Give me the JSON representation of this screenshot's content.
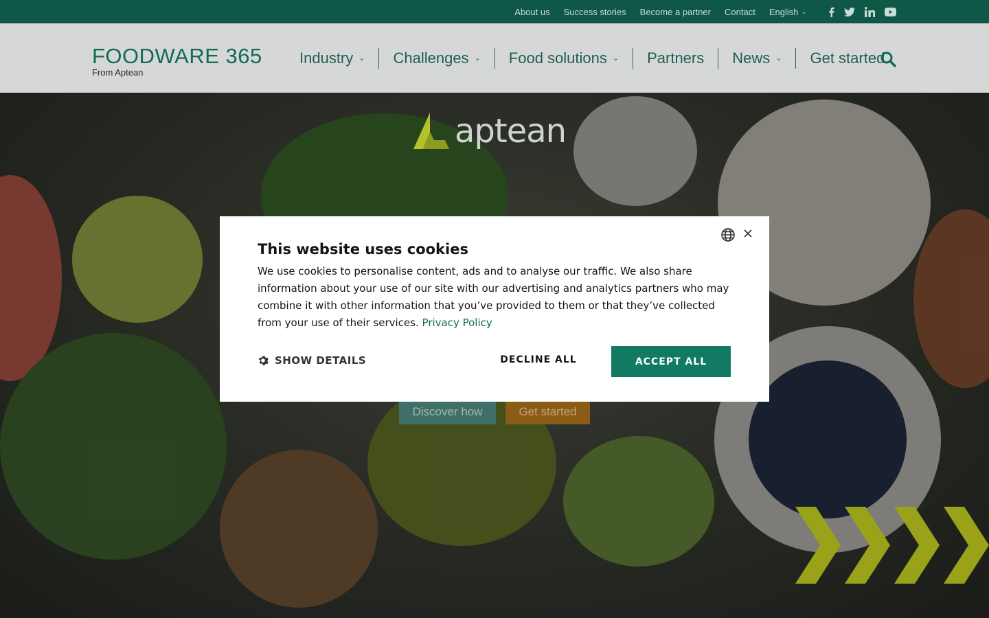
{
  "topbar": {
    "links": [
      "About us",
      "Success stories",
      "Become a partner",
      "Contact"
    ],
    "language": "English",
    "social_icons": [
      "facebook-icon",
      "twitter-icon",
      "linkedin-icon",
      "youtube-icon"
    ]
  },
  "header": {
    "logo_text": "FOODWARE 365",
    "logo_sub": "From Aptean",
    "nav": [
      {
        "label": "Industry",
        "dropdown": true
      },
      {
        "label": "Challenges",
        "dropdown": true
      },
      {
        "label": "Food solutions",
        "dropdown": true
      },
      {
        "label": "Partners",
        "dropdown": false
      },
      {
        "label": "News",
        "dropdown": true
      },
      {
        "label": "Get started",
        "dropdown": false
      }
    ],
    "search_icon": "search-icon"
  },
  "hero": {
    "brand_logo": "aptean",
    "buttons": {
      "discover": "Discover how",
      "get_started": "Get started"
    }
  },
  "cookie_modal": {
    "title": "This website uses cookies",
    "body": "We use cookies to personalise content, ads and to analyse our traffic. We also share information about your use of our site with our advertising and analytics partners who may combine it with other information that you’ve provided to them or that they’ve collected from your use of their services.",
    "privacy_link": "Privacy Policy",
    "show_details": "SHOW DETAILS",
    "decline": "DECLINE ALL",
    "accept": "ACCEPT ALL"
  },
  "colors": {
    "brand_green": "#126a56",
    "topbar_bg": "#0f5848",
    "accept_bg": "#127a63",
    "discover_bg": "#3f6f66",
    "getstarted_bg": "#8b5c16"
  }
}
